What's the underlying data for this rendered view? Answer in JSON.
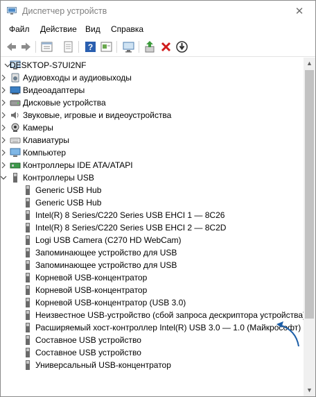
{
  "window": {
    "title": "Диспетчер устройств",
    "close_glyph": "✕"
  },
  "menu": [
    {
      "id": "file",
      "label": "Файл"
    },
    {
      "id": "action",
      "label": "Действие"
    },
    {
      "id": "view",
      "label": "Вид"
    },
    {
      "id": "help",
      "label": "Справка"
    }
  ],
  "toolbar": {
    "icons": [
      "back-arrow-icon",
      "forward-arrow-icon",
      "properties-icon",
      "document-icon",
      "help-icon",
      "show-hidden-icon",
      "monitor-icon",
      "update-driver-icon",
      "uninstall-device-icon",
      "disable-device-icon"
    ]
  },
  "tree": {
    "root": "DESKTOP-S7UI2NF",
    "categories": [
      {
        "label": "Аудиовходы и аудиовыходы",
        "icon": "audio-io-icon",
        "color": "#6b7f90"
      },
      {
        "label": "Видеоадаптеры",
        "icon": "video-adapter-icon",
        "color": "#3a7fc4"
      },
      {
        "label": "Дисковые устройства",
        "icon": "disk-drive-icon",
        "color": "#707070"
      },
      {
        "label": "Звуковые, игровые и видеоустройства",
        "icon": "sound-icon",
        "color": "#707070"
      },
      {
        "label": "Камеры",
        "icon": "camera-icon",
        "color": "#555555"
      },
      {
        "label": "Клавиатуры",
        "icon": "keyboard-icon",
        "color": "#8a8a8a"
      },
      {
        "label": "Компьютер",
        "icon": "computer-icon",
        "color": "#3a8ccf"
      },
      {
        "label": "Контроллеры IDE ATA/ATAPI",
        "icon": "ide-controller-icon",
        "color": "#3d9a4a"
      }
    ],
    "usb_category": "Контроллеры USB",
    "usb_children": [
      "Generic USB Hub",
      "Generic USB Hub",
      "Intel(R) 8 Series/C220 Series USB EHCI 1 — 8C26",
      "Intel(R) 8 Series/C220 Series USB EHCI 2 — 8C2D",
      "Logi USB Camera (C270 HD WebCam)",
      "Запоминающее устройство для USB",
      "Запоминающее устройство для USB",
      "Корневой USB-концентратор",
      "Корневой USB-концентратор",
      "Корневой USB-концентратор (USB 3.0)",
      "Неизвестное USB-устройство (сбой запроса дескриптора устройства)",
      "Расширяемый хост-контроллер Intel(R) USB 3.0 — 1.0 (Майкрософт)",
      "Составное USB устройство",
      "Составное USB устройство",
      "Универсальный USB-концентратор"
    ]
  },
  "colors": {
    "annotation_arrow": "#1d5fa8",
    "selection": "#cce8ff"
  }
}
